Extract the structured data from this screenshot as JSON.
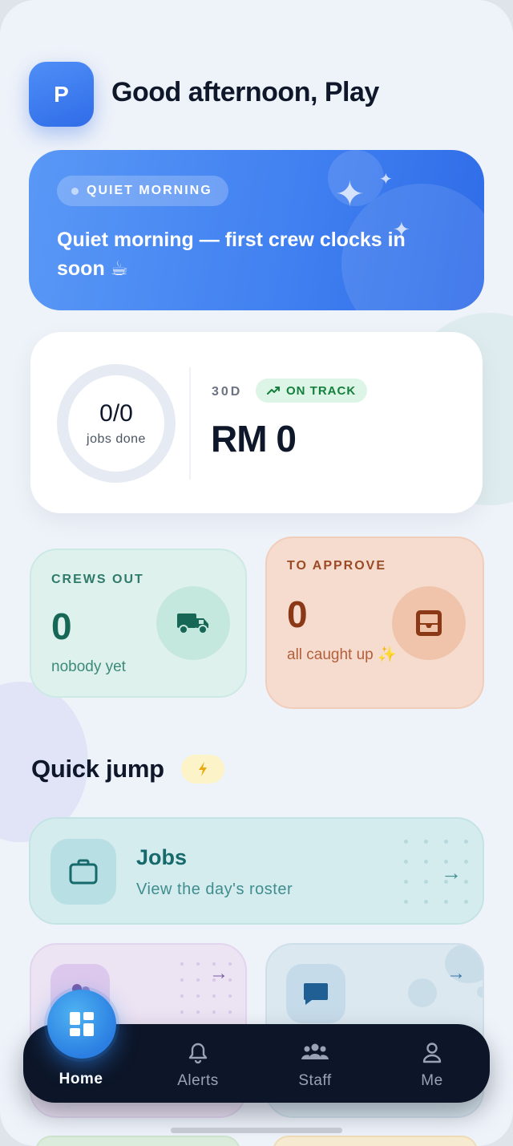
{
  "header": {
    "avatar_initial": "P",
    "greeting": "Good afternoon, Play"
  },
  "hero": {
    "pill_label": "QUIET MORNING",
    "message": "Quiet morning — first crew clocks in soon ☕"
  },
  "stats": {
    "jobs_value": "0/0",
    "jobs_label": "jobs done",
    "jobs_progress": 0,
    "period": "30D",
    "status_badge": "ON TRACK",
    "revenue": "RM 0"
  },
  "crews_card": {
    "title": "CREWS OUT",
    "value": "0",
    "subtitle": "nobody yet",
    "icon": "truck-icon"
  },
  "approve_card": {
    "title": "TO APPROVE",
    "value": "0",
    "subtitle": "all caught up ✨",
    "icon": "inbox-icon"
  },
  "quick_jump": {
    "title": "Quick jump",
    "badge_icon": "lightning-icon",
    "jobs": {
      "label": "Jobs",
      "description": "View the day's roster",
      "icon": "briefcase-icon"
    },
    "tile_left_icon": "people-icon",
    "tile_right_icon": "chat-icon"
  },
  "nav": {
    "home": "Home",
    "alerts": "Alerts",
    "staff": "Staff",
    "me": "Me"
  },
  "colors": {
    "primary": "#2f6ce8",
    "nav_bg": "#0d1629",
    "crews": "#176757",
    "approve": "#8a3816",
    "jobs": "#166a6c",
    "on_track": "#15803d"
  }
}
